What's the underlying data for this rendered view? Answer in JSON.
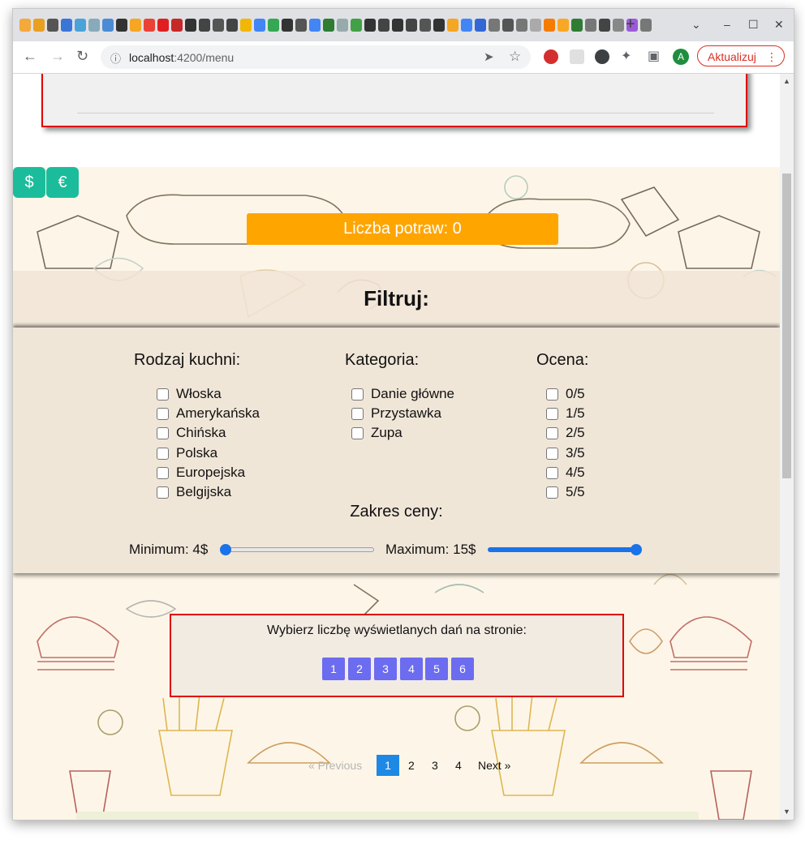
{
  "browser": {
    "url_host": "localhost",
    "url_path": ":4200/menu",
    "update_label": "Aktualizuj",
    "avatar_letter": "A",
    "newtab_symbol": "+",
    "minimize_symbol": "–",
    "maximize_symbol": "☐",
    "close_symbol": "✕",
    "tab_menu_symbol": "⌄",
    "back_symbol": "←",
    "forward_symbol": "→",
    "reload_symbol": "↻",
    "info_symbol": "ⓘ",
    "send_symbol": "➤",
    "star_symbol": "☆",
    "menu_symbol": "⋮",
    "puzzle_symbol": "✦",
    "sidepanel_symbol": "▣"
  },
  "page": {
    "currency_buttons": [
      "$",
      "€"
    ],
    "dish_count_label": "Liczba potraw: 0",
    "filter_heading": "Filtruj:",
    "cuisine": {
      "title": "Rodzaj kuchni:",
      "options": [
        "Włoska",
        "Amerykańska",
        "Chińska",
        "Polska",
        "Europejska",
        "Belgijska"
      ]
    },
    "category": {
      "title": "Kategoria:",
      "options": [
        "Danie główne",
        "Przystawka",
        "Zupa"
      ]
    },
    "rating": {
      "title": "Ocena:",
      "options": [
        "0/5",
        "1/5",
        "2/5",
        "3/5",
        "4/5",
        "5/5"
      ]
    },
    "price_range": {
      "title": "Zakres ceny:",
      "min_label": "Minimum: 4$",
      "max_label": "Maximum: 15$",
      "min_slider_fraction": 0.0,
      "max_slider_fraction": 1.0
    },
    "per_page": {
      "prompt": "Wybierz liczbę wyświetlanych dań na stronie:",
      "options": [
        "1",
        "2",
        "3",
        "4",
        "5",
        "6"
      ]
    },
    "pagination": {
      "previous": "« Previous",
      "pages": [
        "1",
        "2",
        "3",
        "4"
      ],
      "active_page": "1",
      "next": "Next »"
    }
  },
  "colors": {
    "accent_orange": "#ffa500",
    "currency_teal": "#1bbc9b",
    "border_red": "#e00000",
    "perpage_blue": "#6c6cf0",
    "pager_active_blue": "#1e88e5",
    "slider_blue": "#1a73e8"
  }
}
